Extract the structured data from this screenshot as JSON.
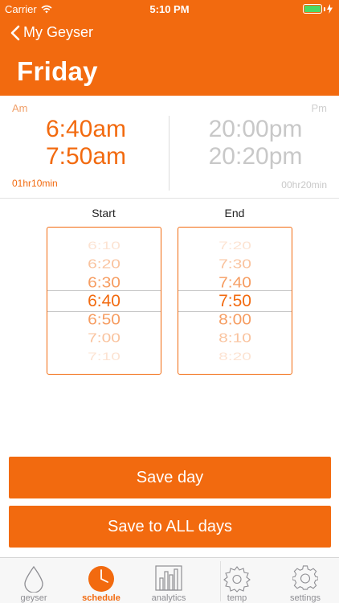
{
  "status_bar": {
    "carrier": "Carrier",
    "time": "5:10 PM"
  },
  "header": {
    "back_label": "My Geyser",
    "title": "Friday"
  },
  "times": {
    "am_label": "Am",
    "pm_label": "Pm",
    "am_start": "6:40am",
    "am_end": "7:50am",
    "am_duration": "01hr10min",
    "pm_start": "20:00pm",
    "pm_end": "20:20pm",
    "pm_duration": "00hr20min"
  },
  "pickers": {
    "start": {
      "label": "Start",
      "items": [
        "6:10",
        "6:20",
        "6:30",
        "6:40",
        "6:50",
        "7:00",
        "7:10"
      ],
      "selected": "6:40"
    },
    "end": {
      "label": "End",
      "items": [
        "7:20",
        "7:30",
        "7:40",
        "7:50",
        "8:00",
        "8:10",
        "8:20"
      ],
      "selected": "7:50"
    }
  },
  "buttons": {
    "save_day": "Save day",
    "save_all": "Save to ALL days"
  },
  "tabs": [
    {
      "label": "geyser",
      "icon": "drop-icon"
    },
    {
      "label": "schedule",
      "icon": "clock-icon",
      "active": true
    },
    {
      "label": "analytics",
      "icon": "bar-chart-icon"
    },
    {
      "label": "temp",
      "icon": "gear-outline-icon"
    },
    {
      "label": "settings",
      "icon": "gear-icon"
    }
  ],
  "colors": {
    "accent": "#f26a0f",
    "inactive": "#8e8e93",
    "battery": "#4cd964"
  }
}
